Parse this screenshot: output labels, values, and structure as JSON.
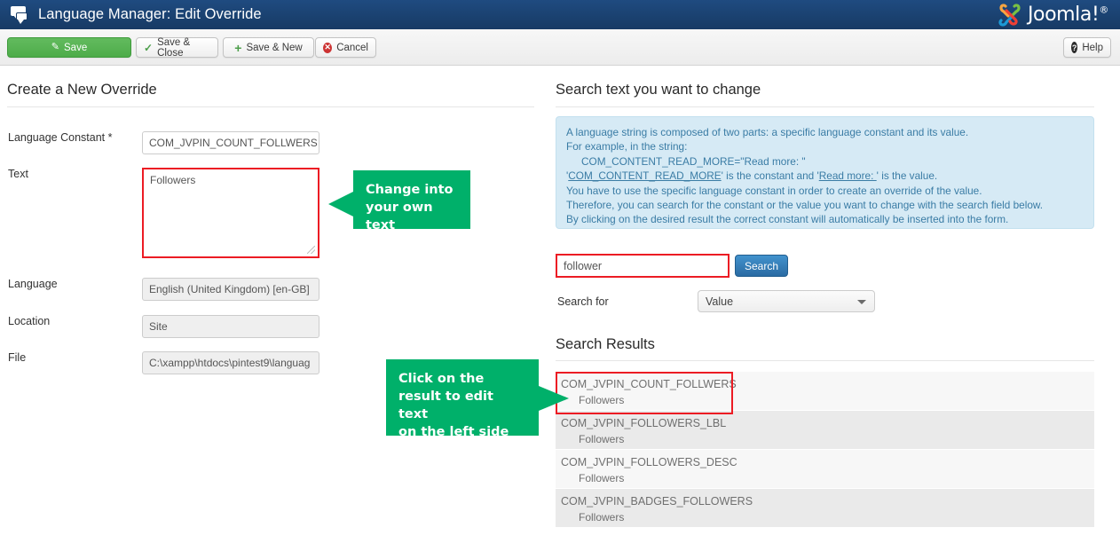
{
  "header": {
    "icon": "comments-icon",
    "title": "Language Manager: Edit Override",
    "brand": "Joomla!",
    "brand_sup": "®"
  },
  "toolbar": {
    "save_label": "Save",
    "save_close_label": "Save & Close",
    "save_new_label": "Save & New",
    "cancel_label": "Cancel",
    "help_label": "Help",
    "icons": {
      "save": "pencil-square-icon",
      "save_close": "check-icon",
      "save_new": "plus-icon",
      "cancel": "cancel-circle-icon",
      "help": "question-circle-icon"
    }
  },
  "left": {
    "title": "Create a New Override",
    "fields": {
      "constant": {
        "label": "Language Constant *",
        "value": "COM_JVPIN_COUNT_FOLLWERS"
      },
      "text": {
        "label": "Text",
        "value": "Followers"
      },
      "language": {
        "label": "Language",
        "value": "English (United Kingdom) [en-GB]"
      },
      "location": {
        "label": "Location",
        "value": "Site"
      },
      "file": {
        "label": "File",
        "value": "C:\\xampp\\htdocs\\pintest9\\languag"
      }
    }
  },
  "right": {
    "title": "Search text you want to change",
    "info_lines": [
      "A language string is composed of two parts: a specific language constant and its value.",
      "For example, in the string:",
      "COM_CONTENT_READ_MORE=\"Read more: \"",
      "'COM_CONTENT_READ_MORE' is the constant and 'Read more: ' is the value.",
      "You have to use the specific language constant in order to create an override of the value.",
      "Therefore, you can search for the constant or the value you want to change with the search field below.",
      "By clicking on the desired result the correct constant will automatically be inserted into the form."
    ],
    "info_line4": {
      "pre": "'",
      "underline1": "COM_CONTENT_READ_MORE",
      "mid": "' is the constant and '",
      "underline2": "Read more: ",
      "post": "' is the value."
    },
    "search": {
      "value": "follower",
      "button_label": "Search",
      "search_for_label": "Search for",
      "search_for_value": "Value"
    },
    "results_title": "Search Results",
    "results": [
      {
        "constant": "COM_JVPIN_COUNT_FOLLWERS",
        "value": "Followers"
      },
      {
        "constant": "COM_JVPIN_FOLLOWERS_LBL",
        "value": "Followers"
      },
      {
        "constant": "COM_JVPIN_FOLLOWERS_DESC",
        "value": "Followers"
      },
      {
        "constant": "COM_JVPIN_BADGES_FOLLOWERS",
        "value": "Followers"
      }
    ]
  },
  "callouts": {
    "text_callout_line1": "Change into",
    "text_callout_line2": "your own text",
    "result_callout_line1": "Click on the",
    "result_callout_line2": "result to edit text",
    "result_callout_line3": "on the left side"
  },
  "colors": {
    "header_bg": "#1f4b80",
    "save_green": "#4eac4a",
    "callout_green": "#00b06a",
    "highlight_red": "#ec1c24",
    "info_bg": "#d6eaf5",
    "info_text": "#3a7ca5",
    "search_blue": "#2a6ba3"
  }
}
